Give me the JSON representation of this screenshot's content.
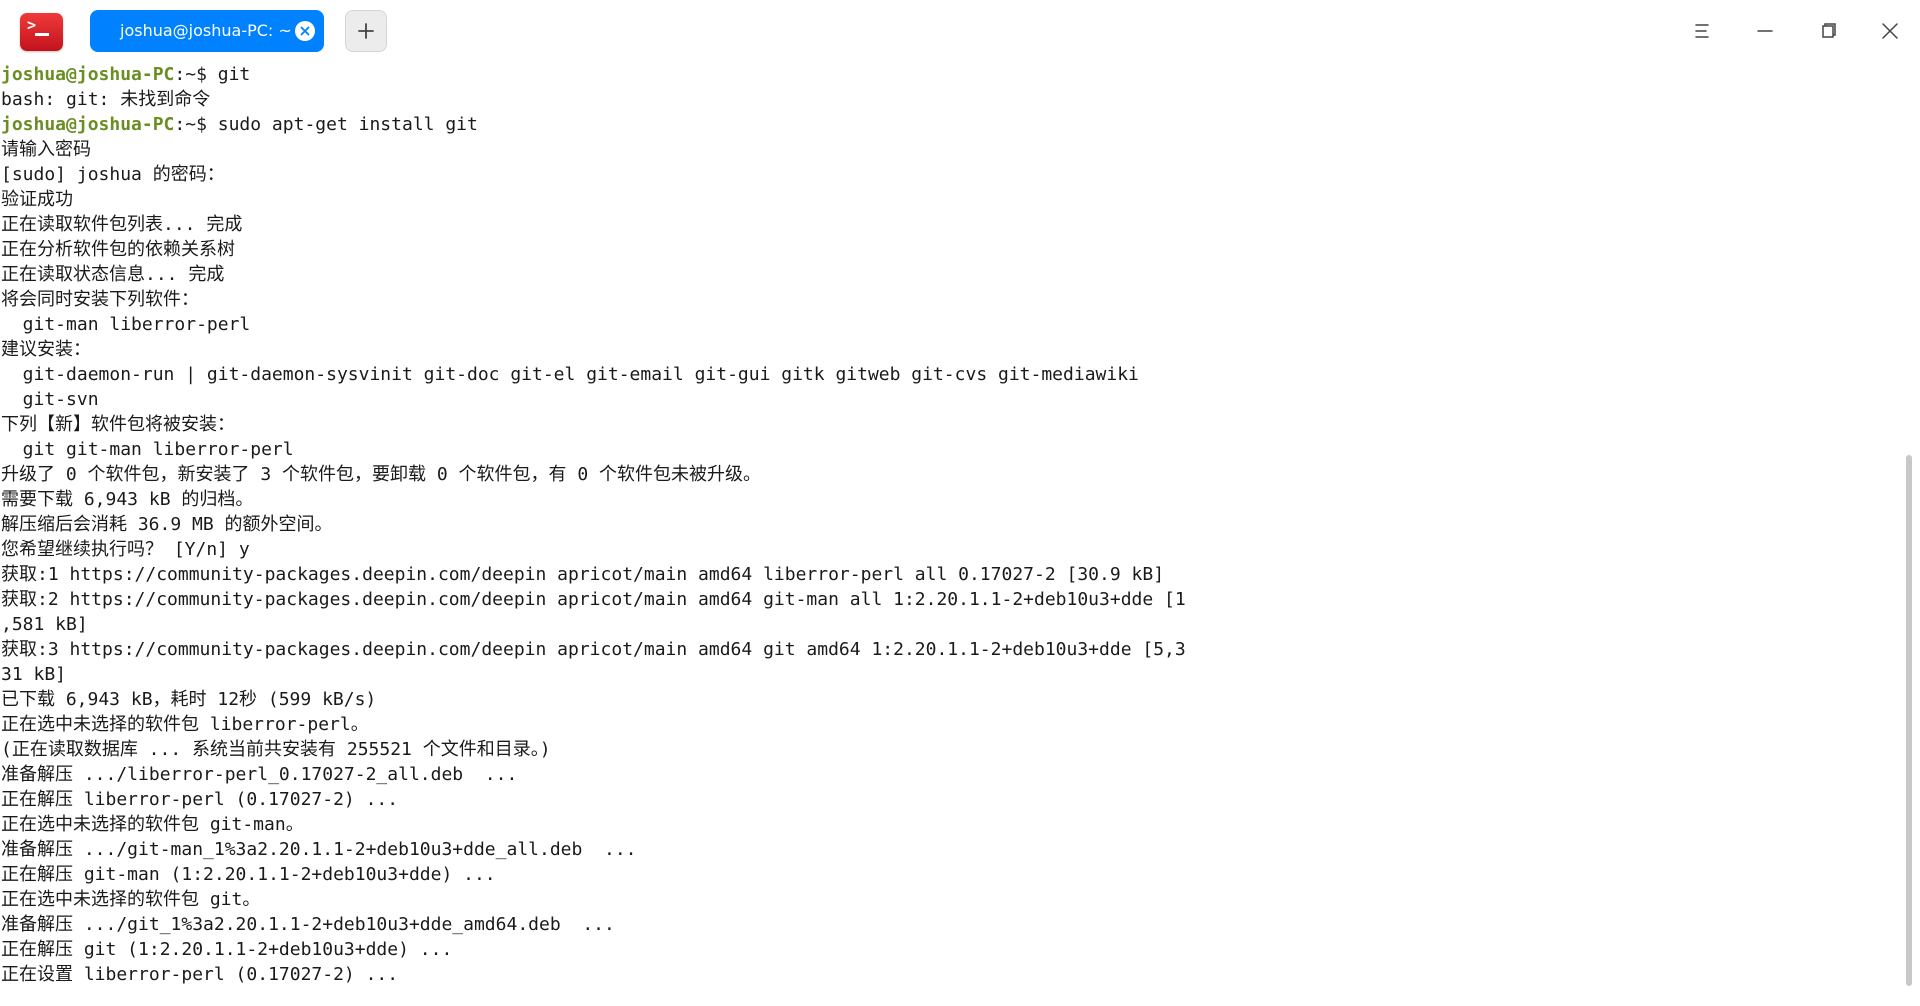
{
  "window": {
    "app_icon": "terminal-icon",
    "tab_title": "joshua@joshua-PC: ~",
    "new_tab_icon": "plus-icon",
    "menu_icon": "menu-icon",
    "minimize_icon": "minimize-icon",
    "maximize_icon": "maximize-icon",
    "close_icon": "close-icon"
  },
  "terminal": {
    "prompt_user": "joshua@joshua-PC",
    "prompt_path": ":~$ ",
    "lines": [
      {
        "type": "prompt",
        "command": "git"
      },
      {
        "type": "text",
        "text": "bash: git: 未找到命令"
      },
      {
        "type": "prompt",
        "command": "sudo apt-get install git"
      },
      {
        "type": "text",
        "text": "请输入密码"
      },
      {
        "type": "text",
        "text": "[sudo] joshua 的密码："
      },
      {
        "type": "text",
        "text": "验证成功"
      },
      {
        "type": "text",
        "text": "正在读取软件包列表... 完成"
      },
      {
        "type": "text",
        "text": "正在分析软件包的依赖关系树"
      },
      {
        "type": "text",
        "text": "正在读取状态信息... 完成"
      },
      {
        "type": "text",
        "text": "将会同时安装下列软件："
      },
      {
        "type": "text",
        "text": "  git-man liberror-perl"
      },
      {
        "type": "text",
        "text": "建议安装："
      },
      {
        "type": "text",
        "text": "  git-daemon-run | git-daemon-sysvinit git-doc git-el git-email git-gui gitk gitweb git-cvs git-mediawiki"
      },
      {
        "type": "text",
        "text": "  git-svn"
      },
      {
        "type": "text",
        "text": "下列【新】软件包将被安装："
      },
      {
        "type": "text",
        "text": "  git git-man liberror-perl"
      },
      {
        "type": "text",
        "text": "升级了 0 个软件包，新安装了 3 个软件包，要卸载 0 个软件包，有 0 个软件包未被升级。"
      },
      {
        "type": "text",
        "text": "需要下载 6,943 kB 的归档。"
      },
      {
        "type": "text",
        "text": "解压缩后会消耗 36.9 MB 的额外空间。"
      },
      {
        "type": "text",
        "text": "您希望继续执行吗？ [Y/n] y"
      },
      {
        "type": "text",
        "text": "获取:1 https://community-packages.deepin.com/deepin apricot/main amd64 liberror-perl all 0.17027-2 [30.9 kB]"
      },
      {
        "type": "text",
        "text": "获取:2 https://community-packages.deepin.com/deepin apricot/main amd64 git-man all 1:2.20.1.1-2+deb10u3+dde [1"
      },
      {
        "type": "text",
        "text": ",581 kB]"
      },
      {
        "type": "text",
        "text": "获取:3 https://community-packages.deepin.com/deepin apricot/main amd64 git amd64 1:2.20.1.1-2+deb10u3+dde [5,3"
      },
      {
        "type": "text",
        "text": "31 kB]"
      },
      {
        "type": "text",
        "text": "已下载 6,943 kB，耗时 12秒 (599 kB/s)"
      },
      {
        "type": "text",
        "text": "正在选中未选择的软件包 liberror-perl。"
      },
      {
        "type": "text",
        "text": "(正在读取数据库 ... 系统当前共安装有 255521 个文件和目录。)"
      },
      {
        "type": "text",
        "text": "准备解压 .../liberror-perl_0.17027-2_all.deb  ..."
      },
      {
        "type": "text",
        "text": "正在解压 liberror-perl (0.17027-2) ..."
      },
      {
        "type": "text",
        "text": "正在选中未选择的软件包 git-man。"
      },
      {
        "type": "text",
        "text": "准备解压 .../git-man_1%3a2.20.1.1-2+deb10u3+dde_all.deb  ..."
      },
      {
        "type": "text",
        "text": "正在解压 git-man (1:2.20.1.1-2+deb10u3+dde) ..."
      },
      {
        "type": "text",
        "text": "正在选中未选择的软件包 git。"
      },
      {
        "type": "text",
        "text": "准备解压 .../git_1%3a2.20.1.1-2+deb10u3+dde_amd64.deb  ..."
      },
      {
        "type": "text",
        "text": "正在解压 git (1:2.20.1.1-2+deb10u3+dde) ..."
      },
      {
        "type": "text",
        "text": "正在设置 liberror-perl (0.17027-2) ..."
      }
    ]
  },
  "colors": {
    "tab_active": "#0081ff",
    "prompt_user": "#6b8e23",
    "app_icon": "#d81e2a",
    "text": "#1a1a1a"
  }
}
